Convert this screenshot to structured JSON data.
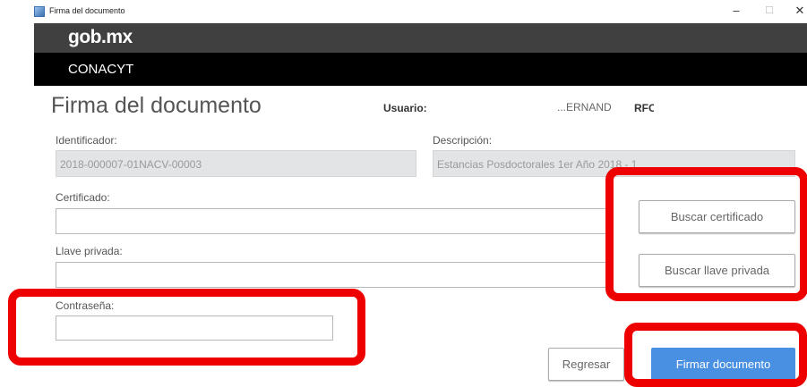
{
  "window": {
    "title": "Firma del documento",
    "app_icon": "java-app-icon",
    "minimize": "–",
    "maximize": "☐",
    "close": "✕"
  },
  "header": {
    "logo": "gob.mx",
    "institution": "CONACYT"
  },
  "page": {
    "title": "Firma del documento",
    "user_label": "Usuario:",
    "user_value": "ERNAND...",
    "rfc_label": "RFC"
  },
  "form": {
    "identificador_label": "Identificador:",
    "identificador_value": "2018-000007-01NACV-00003",
    "descripcion_label": "Descripción:",
    "descripcion_value": "Estancias Posdoctorales 1er Año 2018 - 1",
    "certificado_label": "Certificado:",
    "certificado_value": "",
    "llave_label": "Llave privada:",
    "llave_value": "",
    "password_label": "Contraseña:",
    "password_value": ""
  },
  "buttons": {
    "buscar_certificado": "Buscar certificado",
    "buscar_llave": "Buscar llave privada",
    "regresar": "Regresar",
    "firmar": "Firmar documento"
  },
  "colors": {
    "primary": "#4a90e2",
    "highlight": "#ee0000",
    "gob_bar": "#404040",
    "inst_bar": "#000000"
  }
}
